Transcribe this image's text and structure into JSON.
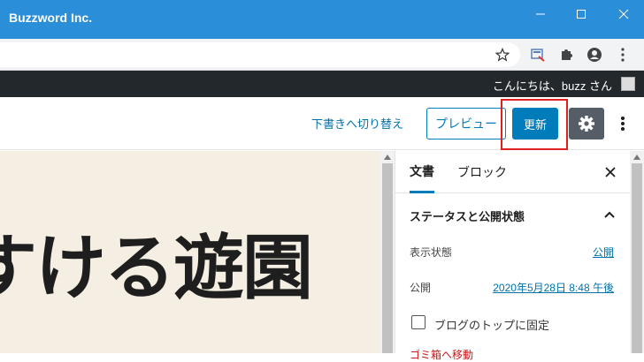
{
  "window": {
    "title": "Buzzword Inc."
  },
  "adminbar": {
    "greeting": "こんにちは、buzz さん"
  },
  "header": {
    "switch_to_draft": "下書きへ切り替え",
    "preview_label": "プレビュー",
    "update_label": "更新"
  },
  "canvas": {
    "post_title_visible": "すける遊園"
  },
  "sidebar": {
    "tabs": [
      {
        "label": "文書",
        "active": true
      },
      {
        "label": "ブロック",
        "active": false
      }
    ],
    "panel": {
      "title": "ステータスと公開状態",
      "rows": [
        {
          "label": "表示状態",
          "value": "公開"
        },
        {
          "label": "公開",
          "value": "2020年5月28日 8:48 午後"
        }
      ],
      "sticky_label": "ブログのトップに固定",
      "trash_label": "ゴミ箱へ移動"
    }
  },
  "colors": {
    "titlebar": "#2b8ed8",
    "adminbar": "#23282d",
    "primary": "#007cba",
    "highlight": "#e0201f",
    "canvas_bg": "#f4efe2"
  }
}
